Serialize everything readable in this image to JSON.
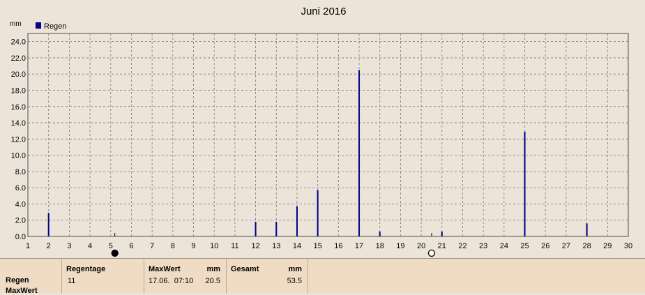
{
  "chart_data": {
    "type": "bar",
    "title": "Juni 2016",
    "ylabel": "mm",
    "legend": [
      "Regen"
    ],
    "legend_position": "top-left",
    "grid": true,
    "ylim": [
      0,
      25
    ],
    "xlim": [
      1,
      30
    ],
    "yticks": [
      "0.0",
      "2.0",
      "4.0",
      "6.0",
      "8.0",
      "10.0",
      "12.0",
      "14.0",
      "16.0",
      "18.0",
      "20.0",
      "22.0",
      "24.0"
    ],
    "xticks": [
      "1",
      "2",
      "3",
      "4",
      "5",
      "6",
      "7",
      "8",
      "9",
      "10",
      "11",
      "12",
      "13",
      "14",
      "15",
      "16",
      "17",
      "18",
      "19",
      "20",
      "21",
      "22",
      "23",
      "24",
      "25",
      "26",
      "27",
      "28",
      "29",
      "30"
    ],
    "series": [
      {
        "name": "Regen",
        "color": "#00008b",
        "points": [
          {
            "x": 2,
            "y": 2.9
          },
          {
            "x": 12,
            "y": 1.8
          },
          {
            "x": 13,
            "y": 1.8
          },
          {
            "x": 14,
            "y": 3.7
          },
          {
            "x": 15,
            "y": 5.7
          },
          {
            "x": 17,
            "y": 20.5
          },
          {
            "x": 18,
            "y": 0.6
          },
          {
            "x": 21,
            "y": 0.6
          },
          {
            "x": 25,
            "y": 12.9
          },
          {
            "x": 28,
            "y": 1.6
          }
        ]
      }
    ],
    "moon_phases": [
      {
        "day": 5.2,
        "phase": "new-moon"
      },
      {
        "day": 20.5,
        "phase": "full-moon"
      }
    ]
  },
  "stats": {
    "row_labels": [
      "Regen",
      "MaxWert"
    ],
    "regentage_label": "Regentage",
    "regentage_value": "11",
    "maxwert_label": "MaxWert",
    "maxwert_unit": "mm",
    "maxwert_time": "17.06.  07:10",
    "maxwert_value": "20.5",
    "gesamt_label": "Gesamt",
    "gesamt_unit": "mm",
    "gesamt_value": "53.5"
  }
}
